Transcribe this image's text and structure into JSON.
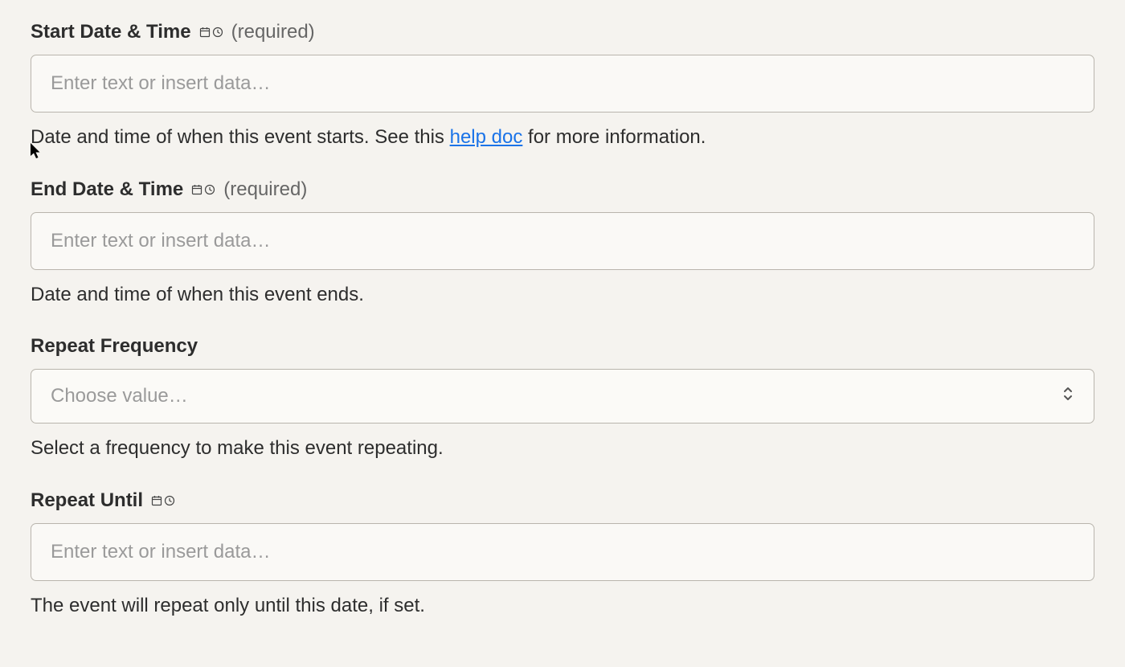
{
  "fields": {
    "startDateTime": {
      "label": "Start Date & Time",
      "required": "(required)",
      "placeholder": "Enter text or insert data…",
      "helpPrefix": "Date and time of when this event starts. See this ",
      "helpLinkText": "help doc",
      "helpSuffix": " for more information."
    },
    "endDateTime": {
      "label": "End Date & Time",
      "required": "(required)",
      "placeholder": "Enter text or insert data…",
      "help": "Date and time of when this event ends."
    },
    "repeatFrequency": {
      "label": "Repeat Frequency",
      "placeholder": "Choose value…",
      "help": "Select a frequency to make this event repeating."
    },
    "repeatUntil": {
      "label": "Repeat Until",
      "placeholder": "Enter text or insert data…",
      "help": "The event will repeat only until this date, if set."
    }
  }
}
